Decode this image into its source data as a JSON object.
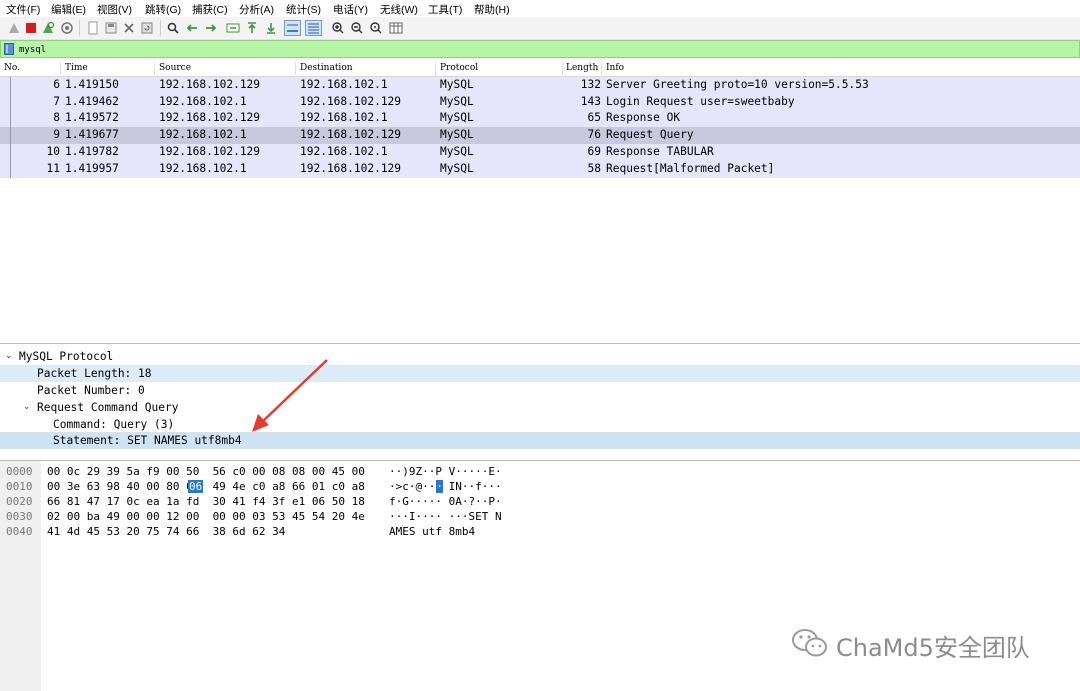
{
  "menu": [
    {
      "label": "文件(F)",
      "id": "file"
    },
    {
      "label": "编辑(E)",
      "id": "edit"
    },
    {
      "label": "视图(V)",
      "id": "view"
    },
    {
      "label": "跳转(G)",
      "id": "go"
    },
    {
      "label": "捕获(C)",
      "id": "capture"
    },
    {
      "label": "分析(A)",
      "id": "analyze"
    },
    {
      "label": "统计(S)",
      "id": "statistics"
    },
    {
      "label": "电话(Y)",
      "id": "telephony"
    },
    {
      "label": "无线(W)",
      "id": "wireless"
    },
    {
      "label": "工具(T)",
      "id": "tools"
    },
    {
      "label": "帮助(H)",
      "id": "help"
    }
  ],
  "filter": {
    "value": "mysql"
  },
  "packet_list": {
    "columns": [
      "No.",
      "Time",
      "Source",
      "Destination",
      "Protocol",
      "Length",
      "Info"
    ],
    "rows": [
      {
        "no": "6",
        "time": "1.419150",
        "src": "192.168.102.129",
        "dst": "192.168.102.1",
        "proto": "MySQL",
        "len": "132",
        "info": "Server Greeting proto=10 version=5.5.53"
      },
      {
        "no": "7",
        "time": "1.419462",
        "src": "192.168.102.1",
        "dst": "192.168.102.129",
        "proto": "MySQL",
        "len": "143",
        "info": "Login Request user=sweetbaby"
      },
      {
        "no": "8",
        "time": "1.419572",
        "src": "192.168.102.129",
        "dst": "192.168.102.1",
        "proto": "MySQL",
        "len": "65",
        "info": "Response OK"
      },
      {
        "no": "9",
        "time": "1.419677",
        "src": "192.168.102.1",
        "dst": "192.168.102.129",
        "proto": "MySQL",
        "len": "76",
        "info": "Request Query"
      },
      {
        "no": "10",
        "time": "1.419782",
        "src": "192.168.102.129",
        "dst": "192.168.102.1",
        "proto": "MySQL",
        "len": "69",
        "info": "Response TABULAR"
      },
      {
        "no": "11",
        "time": "1.419957",
        "src": "192.168.102.1",
        "dst": "192.168.102.129",
        "proto": "MySQL",
        "len": "58",
        "info": "Request[Malformed Packet]"
      }
    ],
    "selected_no": "9"
  },
  "details": {
    "protocol": "MySQL Protocol",
    "packet_length": "Packet Length: 18",
    "packet_number": "Packet Number: 0",
    "request": "Request Command Query",
    "command": "Command: Query (3)",
    "statement": "Statement: SET NAMES utf8mb4"
  },
  "bytes": {
    "rows": [
      {
        "off": "0000",
        "hex": "00 0c 29 39 5a f9 00 50  56 c0 00 08 08 00 45 00",
        "ascii": "··)9Z··P V·····E·"
      },
      {
        "off": "0010",
        "hex": "00 3e 63 98 40 00 80 06  49 4e c0 a8 66 01 c0 a8",
        "ascii": "·>c·@··· IN··f···"
      },
      {
        "off": "0020",
        "hex": "66 81 47 17 0c ea 1a fd  30 41 f4 3f e1 06 50 18",
        "ascii": "f·G····· 0A·?··P·"
      },
      {
        "off": "0030",
        "hex": "02 00 ba 49 00 00 12 00  00 00 03 53 45 54 20 4e",
        "ascii": "···I···· ···SET N"
      },
      {
        "off": "0040",
        "hex": "41 4d 45 53 20 75 74 66  38 6d 62 34",
        "ascii": "AMES utf 8mb4"
      }
    ],
    "highlight_hex": "06",
    "highlight_ascii": "·"
  },
  "watermark": "ChaMd5安全团队",
  "colors": {
    "filter_bg": "#b7f5a6",
    "row_bg": "#e5e5fc",
    "row_selected": "#c9c9de",
    "arrow": "#e83a2f",
    "highlight": "#1f7ad8"
  }
}
